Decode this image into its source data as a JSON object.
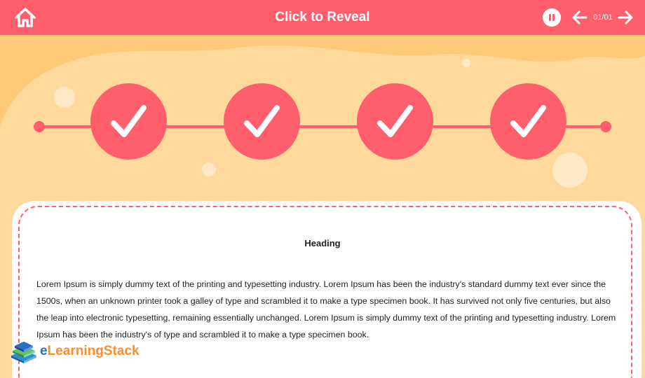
{
  "header": {
    "title": "Click to Reveal",
    "page_counter": "01/01"
  },
  "icons": {
    "home": "home-icon",
    "pause": "pause-icon",
    "prev": "arrow-left-icon",
    "next": "arrow-right-icon",
    "step": "checkmark-icon"
  },
  "timeline": {
    "steps": [
      {
        "state": "completed"
      },
      {
        "state": "completed"
      },
      {
        "state": "completed"
      },
      {
        "state": "completed"
      }
    ]
  },
  "content": {
    "heading": "Heading",
    "paragraph": "Lorem Ipsum is simply dummy text of the printing and typesetting industry. Lorem Ipsum has been the industry's standard dummy text ever since the 1500s, when an unknown printer took a galley of type and scrambled it to make a type specimen book. It has survived not only five centuries, but also the leap into electronic typesetting, remaining essentially unchanged. Lorem Ipsum is simply dummy text of the printing and typesetting industry. Lorem Ipsum has been the industry's of type and scrambled it to make a type specimen book."
  },
  "branding": {
    "logo_part1": "e",
    "logo_part2": "LearningStack"
  },
  "colors": {
    "accent": "#ff5e6d",
    "background": "#ffc97a",
    "background_light": "#ffd99b",
    "card": "#ffffff",
    "text": "#222222"
  }
}
